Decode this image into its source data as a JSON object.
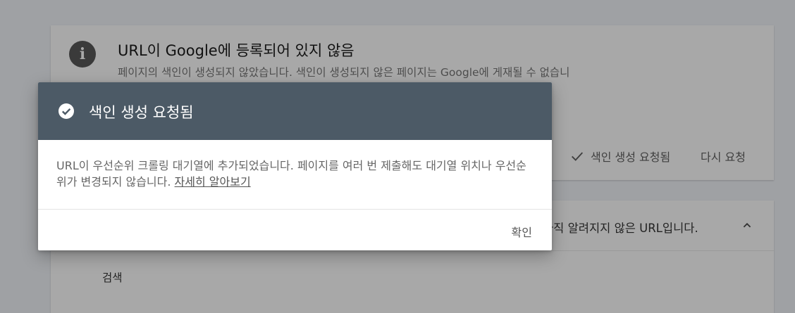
{
  "background": {
    "status_title": "URL이 Google에 등록되어 있지 않음",
    "status_description": "페이지의 색인이 생성되지 않았습니다. 색인이 생성되지 않은 페이지는 Google에 게재될 수 없습니다. 색인이 생성되지 않은 이유를 확인하여 수정이 가능한 경우 색인 생성을 요청하세요.",
    "indexing_requested_label": "색인 생성 요청됨",
    "retry_request_label": "다시 요청",
    "unknown_url_text": "아직 알려지지 않은 URL입니다.",
    "search_label": "검색",
    "info_icon": "info-icon",
    "check_icon": "check-icon",
    "chevron_icon": "chevron-up-icon"
  },
  "dialog": {
    "title": "색인 생성 요청됨",
    "body": "URL이 우선순위 크롤링 대기열에 추가되었습니다. 페이지를 여러 번 제출해도 대기열 위치나 우선순위가 변경되지 않습니다. ",
    "learn_more_link": "자세히 알아보기",
    "ok_button": "확인",
    "header_color": "#4c5a66",
    "icon": "check-circle-icon"
  }
}
